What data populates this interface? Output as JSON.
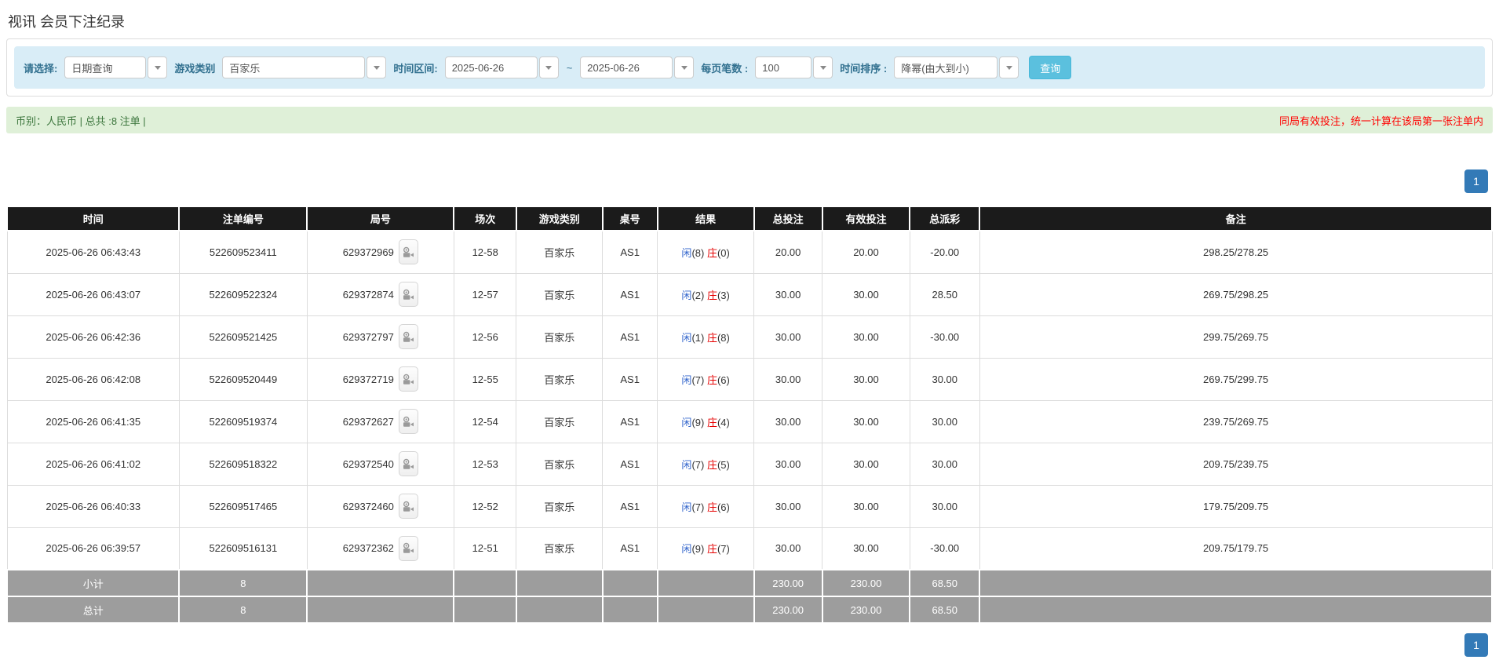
{
  "page": {
    "title": "视讯 会员下注纪录"
  },
  "filters": {
    "choose_label": "请选择:",
    "choose_value": "日期查询",
    "game_type_label": "游戏类别",
    "game_type_value": "百家乐",
    "time_range_label": "时间区间:",
    "date_from": "2025-06-26",
    "date_separator": "~",
    "date_to": "2025-06-26",
    "page_size_label": "每页笔数 :",
    "page_size_value": "100",
    "sort_label": "时间排序 :",
    "sort_value": "降幂(由大到小)",
    "search_button": "查询"
  },
  "summary": {
    "left_text": "币别：人民币 | 总共 :8 注单 |",
    "right_notice": "同局有效投注，统一计算在该局第一张注单内"
  },
  "pagination": {
    "current_page": "1"
  },
  "table": {
    "headers": [
      "时间",
      "注单编号",
      "局号",
      "场次",
      "游戏类别",
      "桌号",
      "结果",
      "总投注",
      "有效投注",
      "总派彩",
      "备注"
    ],
    "player_label": "闲",
    "banker_label": "庄",
    "rows": [
      {
        "time": "2025-06-26 06:43:43",
        "bet_id": "522609523411",
        "round_id": "629372969",
        "session": "12-58",
        "game_type": "百家乐",
        "table_no": "AS1",
        "result_player": "(8)",
        "result_banker": "(0)",
        "total_bet": "20.00",
        "valid_bet": "20.00",
        "payout": "-20.00",
        "note": "298.25/278.25"
      },
      {
        "time": "2025-06-26 06:43:07",
        "bet_id": "522609522324",
        "round_id": "629372874",
        "session": "12-57",
        "game_type": "百家乐",
        "table_no": "AS1",
        "result_player": "(2)",
        "result_banker": "(3)",
        "total_bet": "30.00",
        "valid_bet": "30.00",
        "payout": "28.50",
        "note": "269.75/298.25"
      },
      {
        "time": "2025-06-26 06:42:36",
        "bet_id": "522609521425",
        "round_id": "629372797",
        "session": "12-56",
        "game_type": "百家乐",
        "table_no": "AS1",
        "result_player": "(1)",
        "result_banker": "(8)",
        "total_bet": "30.00",
        "valid_bet": "30.00",
        "payout": "-30.00",
        "note": "299.75/269.75"
      },
      {
        "time": "2025-06-26 06:42:08",
        "bet_id": "522609520449",
        "round_id": "629372719",
        "session": "12-55",
        "game_type": "百家乐",
        "table_no": "AS1",
        "result_player": "(7)",
        "result_banker": "(6)",
        "total_bet": "30.00",
        "valid_bet": "30.00",
        "payout": "30.00",
        "note": "269.75/299.75"
      },
      {
        "time": "2025-06-26 06:41:35",
        "bet_id": "522609519374",
        "round_id": "629372627",
        "session": "12-54",
        "game_type": "百家乐",
        "table_no": "AS1",
        "result_player": "(9)",
        "result_banker": "(4)",
        "total_bet": "30.00",
        "valid_bet": "30.00",
        "payout": "30.00",
        "note": "239.75/269.75"
      },
      {
        "time": "2025-06-26 06:41:02",
        "bet_id": "522609518322",
        "round_id": "629372540",
        "session": "12-53",
        "game_type": "百家乐",
        "table_no": "AS1",
        "result_player": "(7)",
        "result_banker": "(5)",
        "total_bet": "30.00",
        "valid_bet": "30.00",
        "payout": "30.00",
        "note": "209.75/239.75"
      },
      {
        "time": "2025-06-26 06:40:33",
        "bet_id": "522609517465",
        "round_id": "629372460",
        "session": "12-52",
        "game_type": "百家乐",
        "table_no": "AS1",
        "result_player": "(7)",
        "result_banker": "(6)",
        "total_bet": "30.00",
        "valid_bet": "30.00",
        "payout": "30.00",
        "note": "179.75/209.75"
      },
      {
        "time": "2025-06-26 06:39:57",
        "bet_id": "522609516131",
        "round_id": "629372362",
        "session": "12-51",
        "game_type": "百家乐",
        "table_no": "AS1",
        "result_player": "(9)",
        "result_banker": "(7)",
        "total_bet": "30.00",
        "valid_bet": "30.00",
        "payout": "-30.00",
        "note": "209.75/179.75"
      }
    ],
    "footer_rows": [
      {
        "label": "小计",
        "count": "8",
        "total_bet": "230.00",
        "valid_bet": "230.00",
        "payout": "68.50"
      },
      {
        "label": "总计",
        "count": "8",
        "total_bet": "230.00",
        "valid_bet": "230.00",
        "payout": "68.50"
      }
    ]
  },
  "colors": {
    "accent_blue": "#337ab7",
    "button_cyan": "#5bc0de",
    "header_black": "#1b1b1b",
    "footer_gray": "#9d9d9d",
    "filter_bg": "#d9edf7",
    "filter_label": "#31708f",
    "summary_bg": "#dff0d8",
    "summary_text": "#3c763d",
    "notice_red": "#ff0000",
    "negative_red": "#ee0000",
    "player_blue": "#3366cc",
    "banker_red": "#e60000"
  }
}
